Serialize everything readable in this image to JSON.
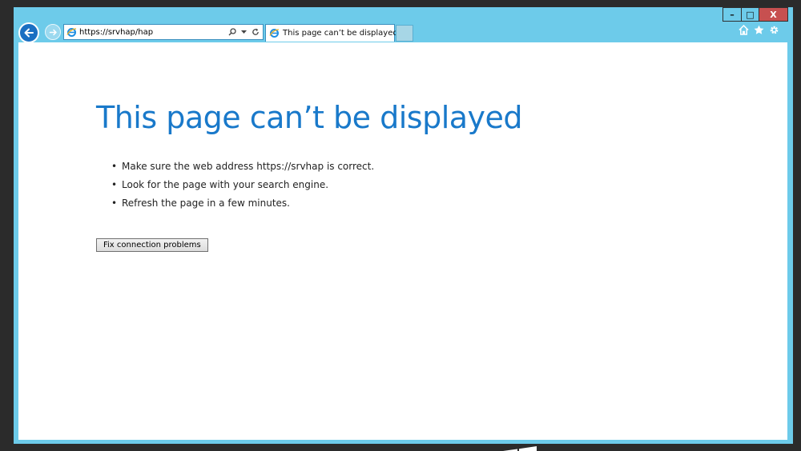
{
  "browser": {
    "address": {
      "value": "https://srvhap/hap"
    },
    "tab": {
      "label": "This page can’t be displayed",
      "close": "✕"
    },
    "window_controls": {
      "minimize": "–",
      "maximize": "□",
      "close": "X"
    },
    "icons": [
      "back-icon",
      "forward-icon",
      "ie-icon",
      "search-icon",
      "dropdown-icon",
      "refresh-icon",
      "home-icon",
      "favorites-icon",
      "settings-icon"
    ]
  },
  "error_page": {
    "title": "This page can’t be displayed",
    "tips": [
      "Make sure the web address https://srvhap is correct.",
      "Look for the page with your search engine.",
      "Refresh the page in a few minutes."
    ],
    "fix_button": "Fix connection problems"
  },
  "colors": {
    "chrome": "#6dcbea",
    "accent": "#1979ca",
    "close_button": "#c75050",
    "desktop": "#2b2b2b"
  }
}
